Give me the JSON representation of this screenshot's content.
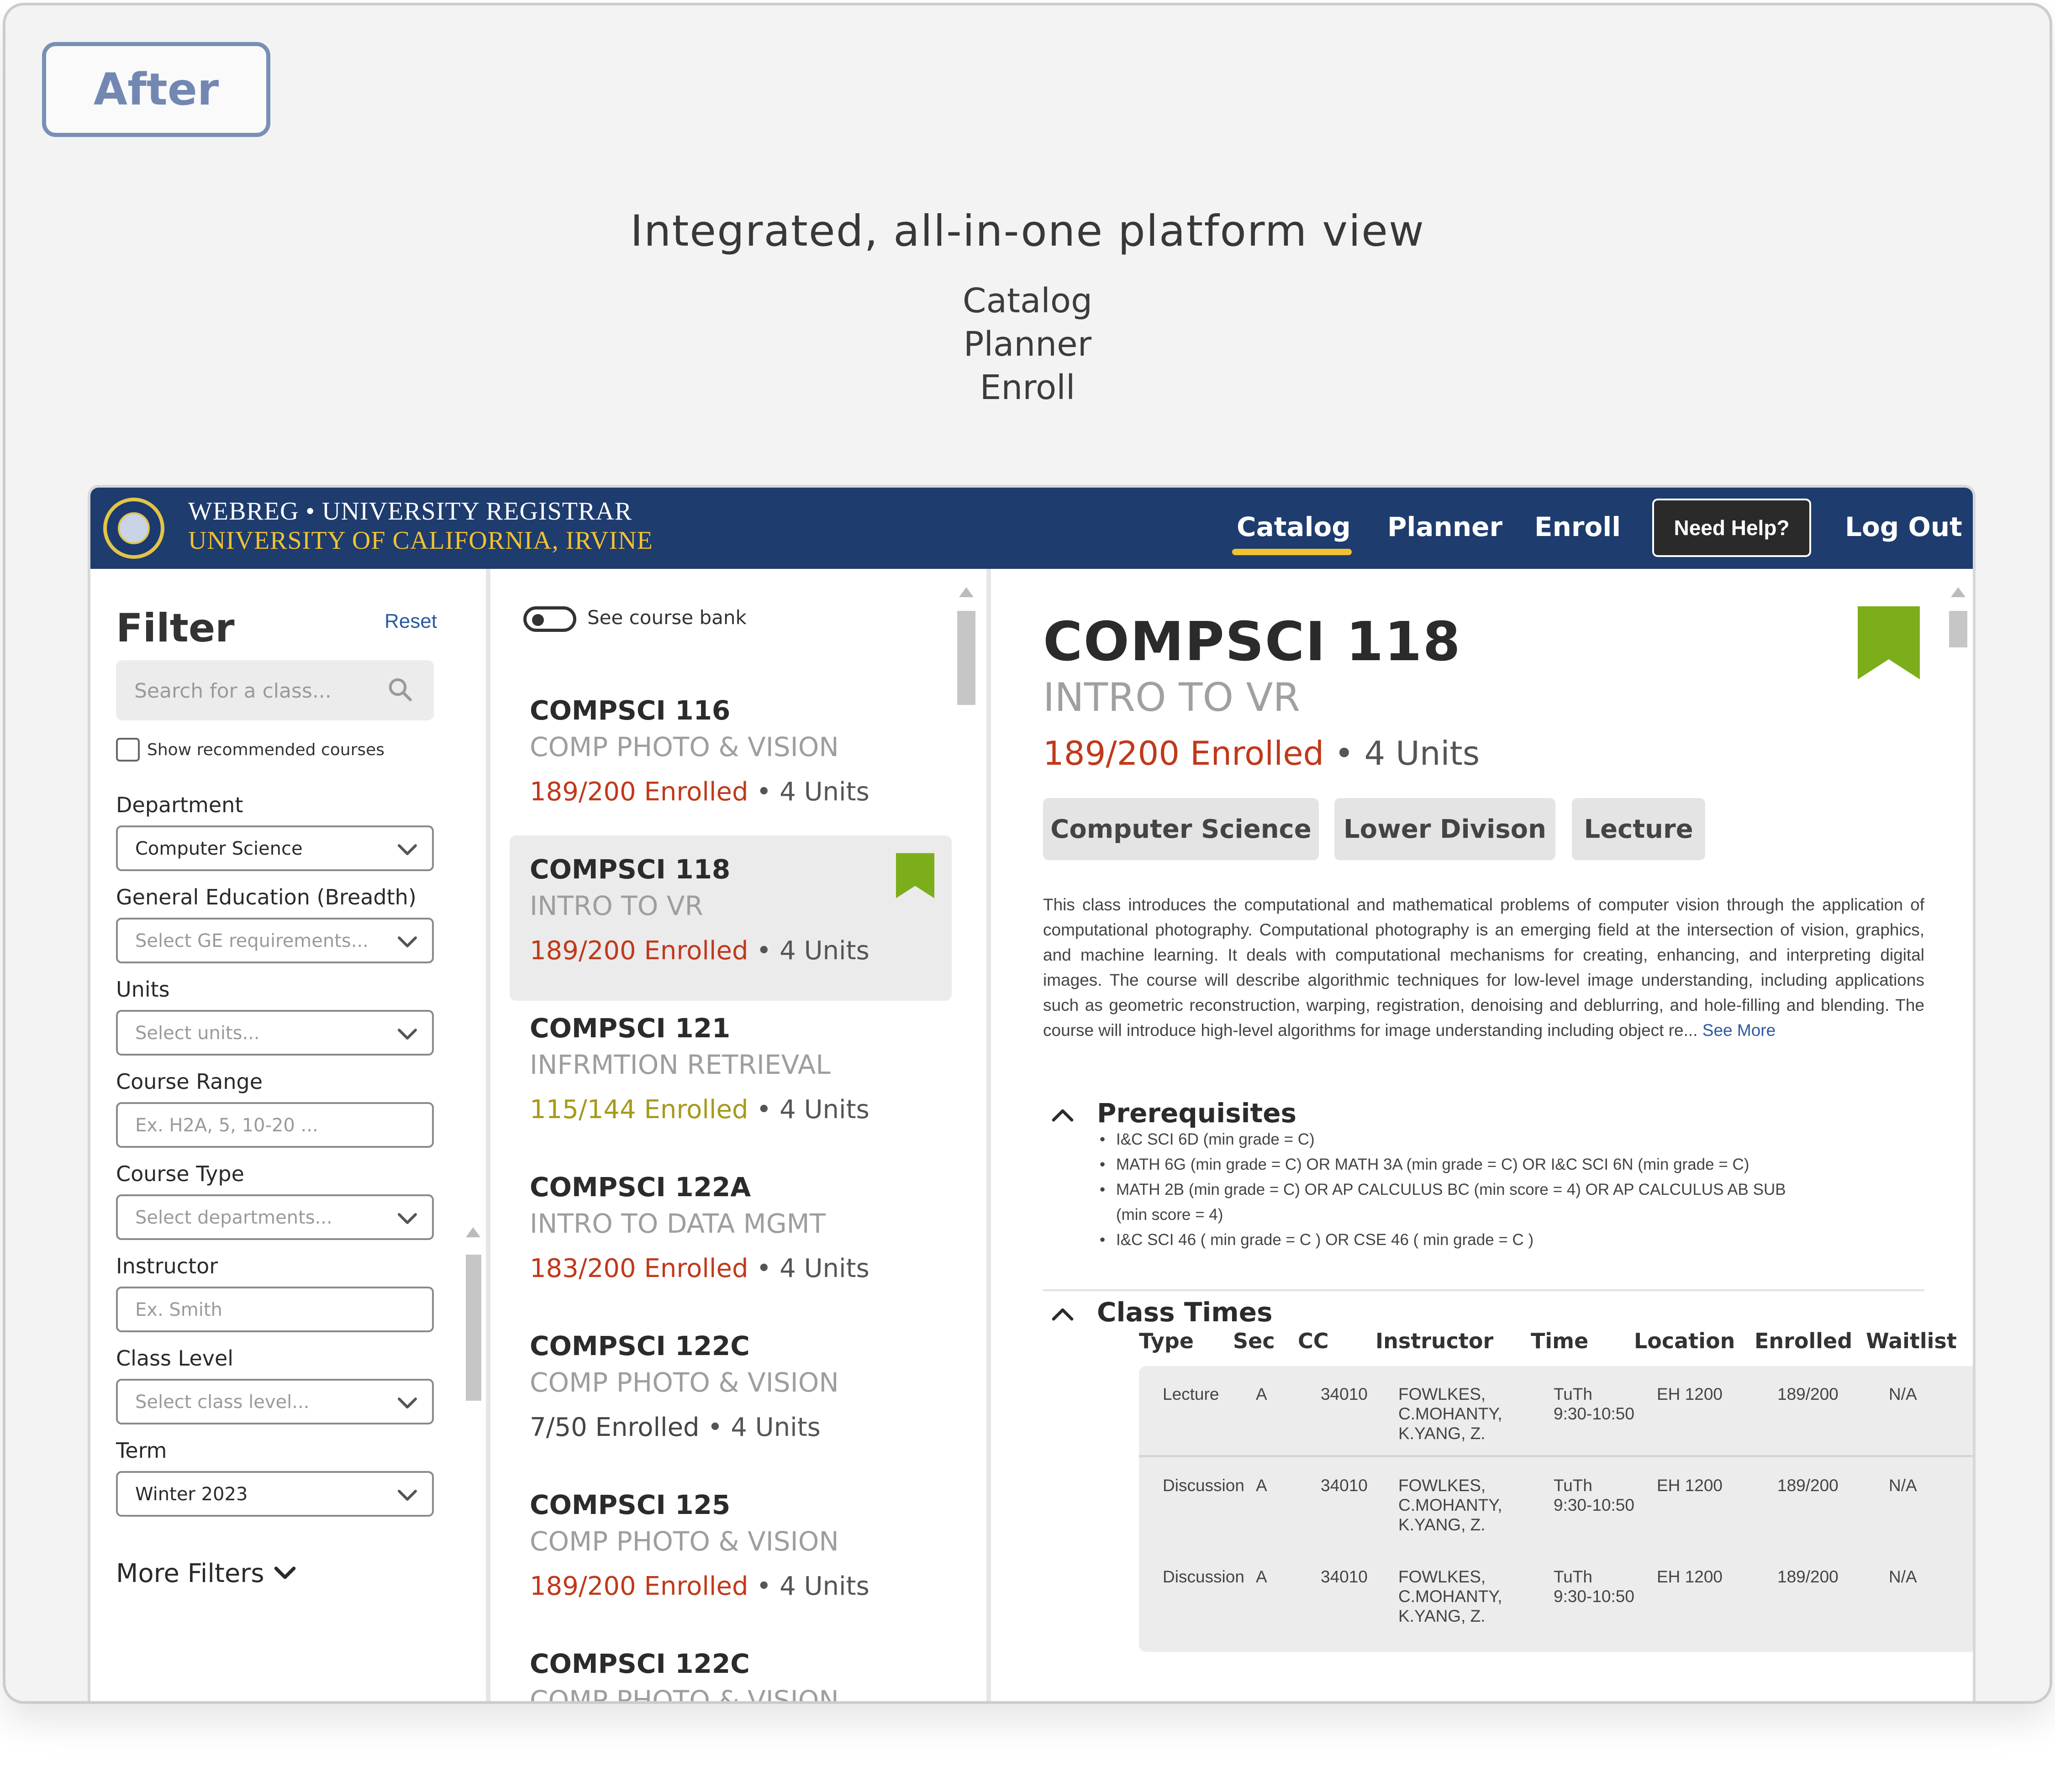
{
  "badge": "After",
  "headline": "Integrated, all-in-one platform view",
  "subtitle_lines": [
    "Catalog",
    "Planner",
    "Enroll"
  ],
  "colors": {
    "header_bg": "#1e3c6e",
    "accent_gold": "#f1c232",
    "bookmark_green": "#7cad1a",
    "enrolled_red": "#c0391b",
    "enrolled_olive": "#a69a1a"
  },
  "header": {
    "brand_line1": "WEBREG • UNIVERSITY REGISTRAR",
    "brand_line2": "UNIVERSITY OF CALIFORNIA, IRVINE",
    "logo_icon": "uc-seal-icon",
    "nav": {
      "catalog": "Catalog",
      "planner": "Planner",
      "enroll": "Enroll",
      "help": "Need Help?",
      "logout": "Log Out"
    },
    "active_nav": "Catalog"
  },
  "filter": {
    "title": "Filter",
    "reset": "Reset",
    "search_placeholder": "Search for a class...",
    "recommended_label": "Show recommended courses",
    "fields": [
      {
        "label": "Department",
        "value": "Computer Science",
        "placeholder": "",
        "type": "select"
      },
      {
        "label": "General Education (Breadth)",
        "value": "",
        "placeholder": "Select GE requirements...",
        "type": "select"
      },
      {
        "label": "Units",
        "value": "",
        "placeholder": "Select units...",
        "type": "select"
      },
      {
        "label": "Course Range",
        "value": "",
        "placeholder": "Ex. H2A, 5, 10-20 ...",
        "type": "input"
      },
      {
        "label": "Course Type",
        "value": "",
        "placeholder": "Select departments...",
        "type": "select"
      },
      {
        "label": "Instructor",
        "value": "",
        "placeholder": "Ex. Smith",
        "type": "input"
      },
      {
        "label": "Class Level",
        "value": "",
        "placeholder": "Select class level...",
        "type": "select"
      },
      {
        "label": "Term",
        "value": "Winter 2023",
        "placeholder": "",
        "type": "select"
      }
    ],
    "more_filters": "More Filters"
  },
  "course_list": {
    "toggle_label": "See course bank",
    "courses": [
      {
        "code": "COMPSCI 116",
        "name": "COMP PHOTO & VISION",
        "enrolled": "189/200 Enrolled",
        "units": "4 Units",
        "status": "red",
        "bookmarked": false,
        "selected": false
      },
      {
        "code": "COMPSCI 118",
        "name": "INTRO TO VR",
        "enrolled": "189/200 Enrolled",
        "units": "4 Units",
        "status": "red",
        "bookmarked": true,
        "selected": true
      },
      {
        "code": "COMPSCI 121",
        "name": "INFRMTION RETRIEVAL",
        "enrolled": "115/144 Enrolled",
        "units": "4 Units",
        "status": "olive",
        "bookmarked": false,
        "selected": false
      },
      {
        "code": "COMPSCI 122A",
        "name": "INTRO TO DATA MGMT",
        "enrolled": "183/200 Enrolled",
        "units": "4 Units",
        "status": "red",
        "bookmarked": false,
        "selected": false
      },
      {
        "code": "COMPSCI 122C",
        "name": "COMP PHOTO & VISION",
        "enrolled": "7/50 Enrolled",
        "units": "4 Units",
        "status": "dark",
        "bookmarked": false,
        "selected": false
      },
      {
        "code": "COMPSCI 125",
        "name": "COMP PHOTO & VISION",
        "enrolled": "189/200 Enrolled",
        "units": "4 Units",
        "status": "red",
        "bookmarked": false,
        "selected": false
      },
      {
        "code": "COMPSCI 122C",
        "name": "COMP PHOTO & VISION",
        "enrolled": "",
        "units": "",
        "status": "red",
        "bookmarked": false,
        "selected": false
      }
    ]
  },
  "detail": {
    "code": "COMPSCI 118",
    "name": "INTRO TO VR",
    "enrolled": "189/200 Enrolled",
    "units": "4 Units",
    "tags": [
      "Computer Science",
      "Lower Divison",
      "Lecture"
    ],
    "description": "This class introduces the computational and mathematical problems of computer vision through the application of computational photography. Computational photography is an emerging field at the intersection of vision, graphics, and machine learning. It deals with computational mechanisms for creating, enhancing, and interpreting digital images. The course will describe algorithmic techniques for low-level image understanding, including applications such as geometric reconstruction, warping, registration, denoising and deblurring, and hole-filling and blending. The course will introduce high-level algorithms for image understanding including object re...",
    "see_more": "See More",
    "prereq_title": "Prerequisites",
    "prereqs": [
      "I&C SCI 6D (min grade = C)",
      "MATH 6G (min grade = C) OR MATH 3A (min grade = C) OR I&C SCI 6N (min grade = C)",
      "MATH 2B (min grade = C) OR AP CALCULUS BC (min score = 4) OR AP CALCULUS AB SUB (min score = 4)",
      "I&C SCI 46 ( min grade = C ) OR CSE 46 ( min grade = C )"
    ],
    "times_title": "Class Times",
    "columns": [
      "Type",
      "Sec",
      "CC",
      "Instructor",
      "Time",
      "Location",
      "Enrolled",
      "Waitlist"
    ],
    "rows": [
      {
        "type": "Lecture",
        "sec": "A",
        "cc": "34010",
        "instructor": [
          "FOWLKES,",
          "C.MOHANTY,",
          "K.YANG, Z."
        ],
        "time": [
          "TuTh",
          "9:30-10:50"
        ],
        "location": "EH 1200",
        "enrolled": "189/200",
        "waitlist": "N/A"
      },
      {
        "type": "Discussion",
        "sec": "A",
        "cc": "34010",
        "instructor": [
          "FOWLKES,",
          "C.MOHANTY,",
          "K.YANG, Z."
        ],
        "time": [
          "TuTh",
          "9:30-10:50"
        ],
        "location": "EH 1200",
        "enrolled": "189/200",
        "waitlist": "N/A"
      },
      {
        "type": "Discussion",
        "sec": "A",
        "cc": "34010",
        "instructor": [
          "FOWLKES,",
          "C.MOHANTY,",
          "K.YANG, Z."
        ],
        "time": [
          "TuTh",
          "9:30-10:50"
        ],
        "location": "EH 1200",
        "enrolled": "189/200",
        "waitlist": "N/A"
      }
    ]
  }
}
